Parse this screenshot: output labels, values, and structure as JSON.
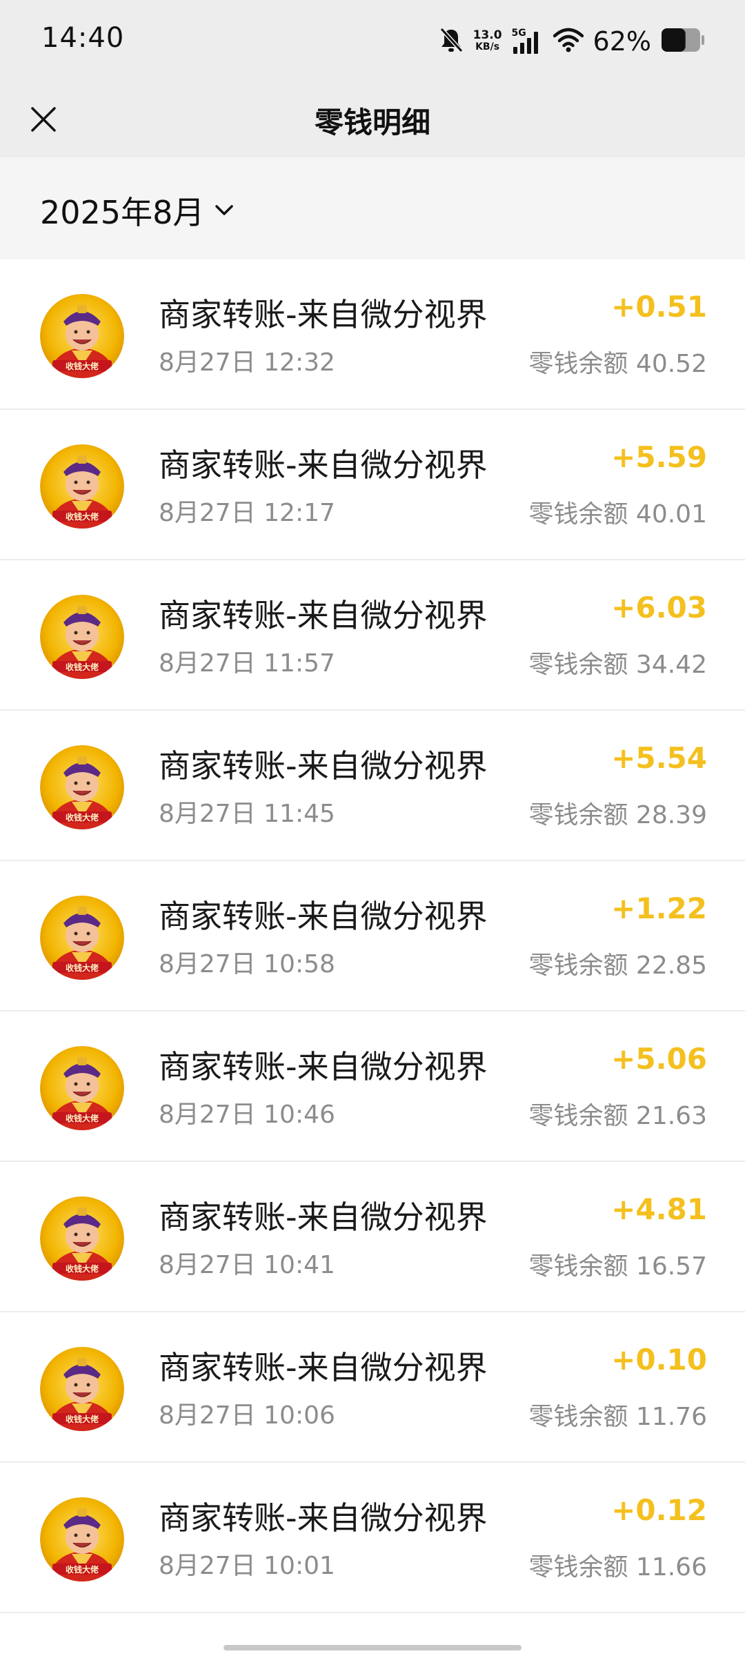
{
  "status_bar": {
    "time": "14:40",
    "net_speed_value": "13.0",
    "net_speed_unit": "KB/s",
    "signal_label": "5G",
    "battery_percent": "62%",
    "battery_level": 0.62,
    "icons": [
      "bell-muted-icon",
      "signal-icon",
      "wifi-icon",
      "battery-icon"
    ]
  },
  "navbar": {
    "title": "零钱明细",
    "close_icon": "close-icon"
  },
  "filter": {
    "month": "2025年8月",
    "dropdown_icon": "chevron-down-icon"
  },
  "colors": {
    "income": "#f4c01e",
    "header_bg": "#ededed",
    "secondary_text": "#8c8c8c"
  },
  "transactions": [
    {
      "title": "商家转账-来自微分视界",
      "time": "8月27日 12:32",
      "amount": "+0.51",
      "balance": "零钱余额 40.52"
    },
    {
      "title": "商家转账-来自微分视界",
      "time": "8月27日 12:17",
      "amount": "+5.59",
      "balance": "零钱余额 40.01"
    },
    {
      "title": "商家转账-来自微分视界",
      "time": "8月27日 11:57",
      "amount": "+6.03",
      "balance": "零钱余额 34.42"
    },
    {
      "title": "商家转账-来自微分视界",
      "time": "8月27日 11:45",
      "amount": "+5.54",
      "balance": "零钱余额 28.39"
    },
    {
      "title": "商家转账-来自微分视界",
      "time": "8月27日 10:58",
      "amount": "+1.22",
      "balance": "零钱余额 22.85"
    },
    {
      "title": "商家转账-来自微分视界",
      "time": "8月27日 10:46",
      "amount": "+5.06",
      "balance": "零钱余额 21.63"
    },
    {
      "title": "商家转账-来自微分视界",
      "time": "8月27日 10:41",
      "amount": "+4.81",
      "balance": "零钱余额 16.57"
    },
    {
      "title": "商家转账-来自微分视界",
      "time": "8月27日 10:06",
      "amount": "+0.10",
      "balance": "零钱余额 11.76"
    },
    {
      "title": "商家转账-来自微分视界",
      "time": "8月27日 10:01",
      "amount": "+0.12",
      "balance": "零钱余额 11.66"
    }
  ]
}
